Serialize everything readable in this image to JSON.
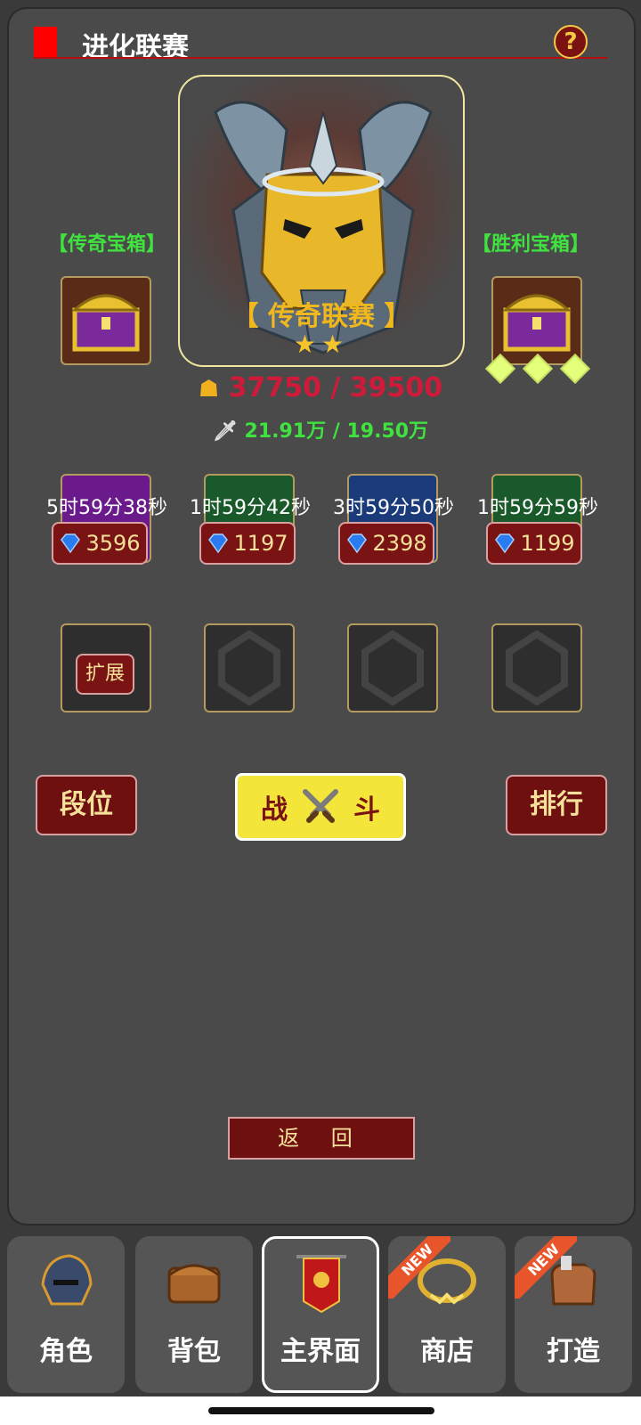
{
  "header": {
    "title": "进化联赛",
    "help": "?"
  },
  "league": {
    "name": "【 传奇联赛 】",
    "stars": "★★"
  },
  "chests": {
    "left_label": "【传奇宝箱】",
    "right_label": "【胜利宝箱】"
  },
  "score": "37750 / 39500",
  "power": "21.91万 / 19.50万",
  "slots": [
    {
      "timer": "5时59分38秒",
      "price": "3596",
      "color": "#6a1a8a"
    },
    {
      "timer": "1时59分42秒",
      "price": "1197",
      "color": "#1a5a2a"
    },
    {
      "timer": "3时59分50秒",
      "price": "2398",
      "color": "#1a3a7a"
    },
    {
      "timer": "1时59分59秒",
      "price": "1199",
      "color": "#1a5a2a"
    }
  ],
  "expand_label": "扩展",
  "buttons": {
    "rank": "段位",
    "fight_left": "战",
    "fight_right": "斗",
    "leaderboard": "排行",
    "back": "返 回"
  },
  "tabs": [
    {
      "label": "角色",
      "icon": "helmet-icon",
      "new": false
    },
    {
      "label": "背包",
      "icon": "backpack-icon",
      "new": false
    },
    {
      "label": "主界面",
      "icon": "banner-icon",
      "new": false,
      "active": true
    },
    {
      "label": "商店",
      "icon": "necklace-icon",
      "new": true,
      "badge": "NEW"
    },
    {
      "label": "打造",
      "icon": "forge-bag-icon",
      "new": true,
      "badge": "NEW"
    }
  ]
}
